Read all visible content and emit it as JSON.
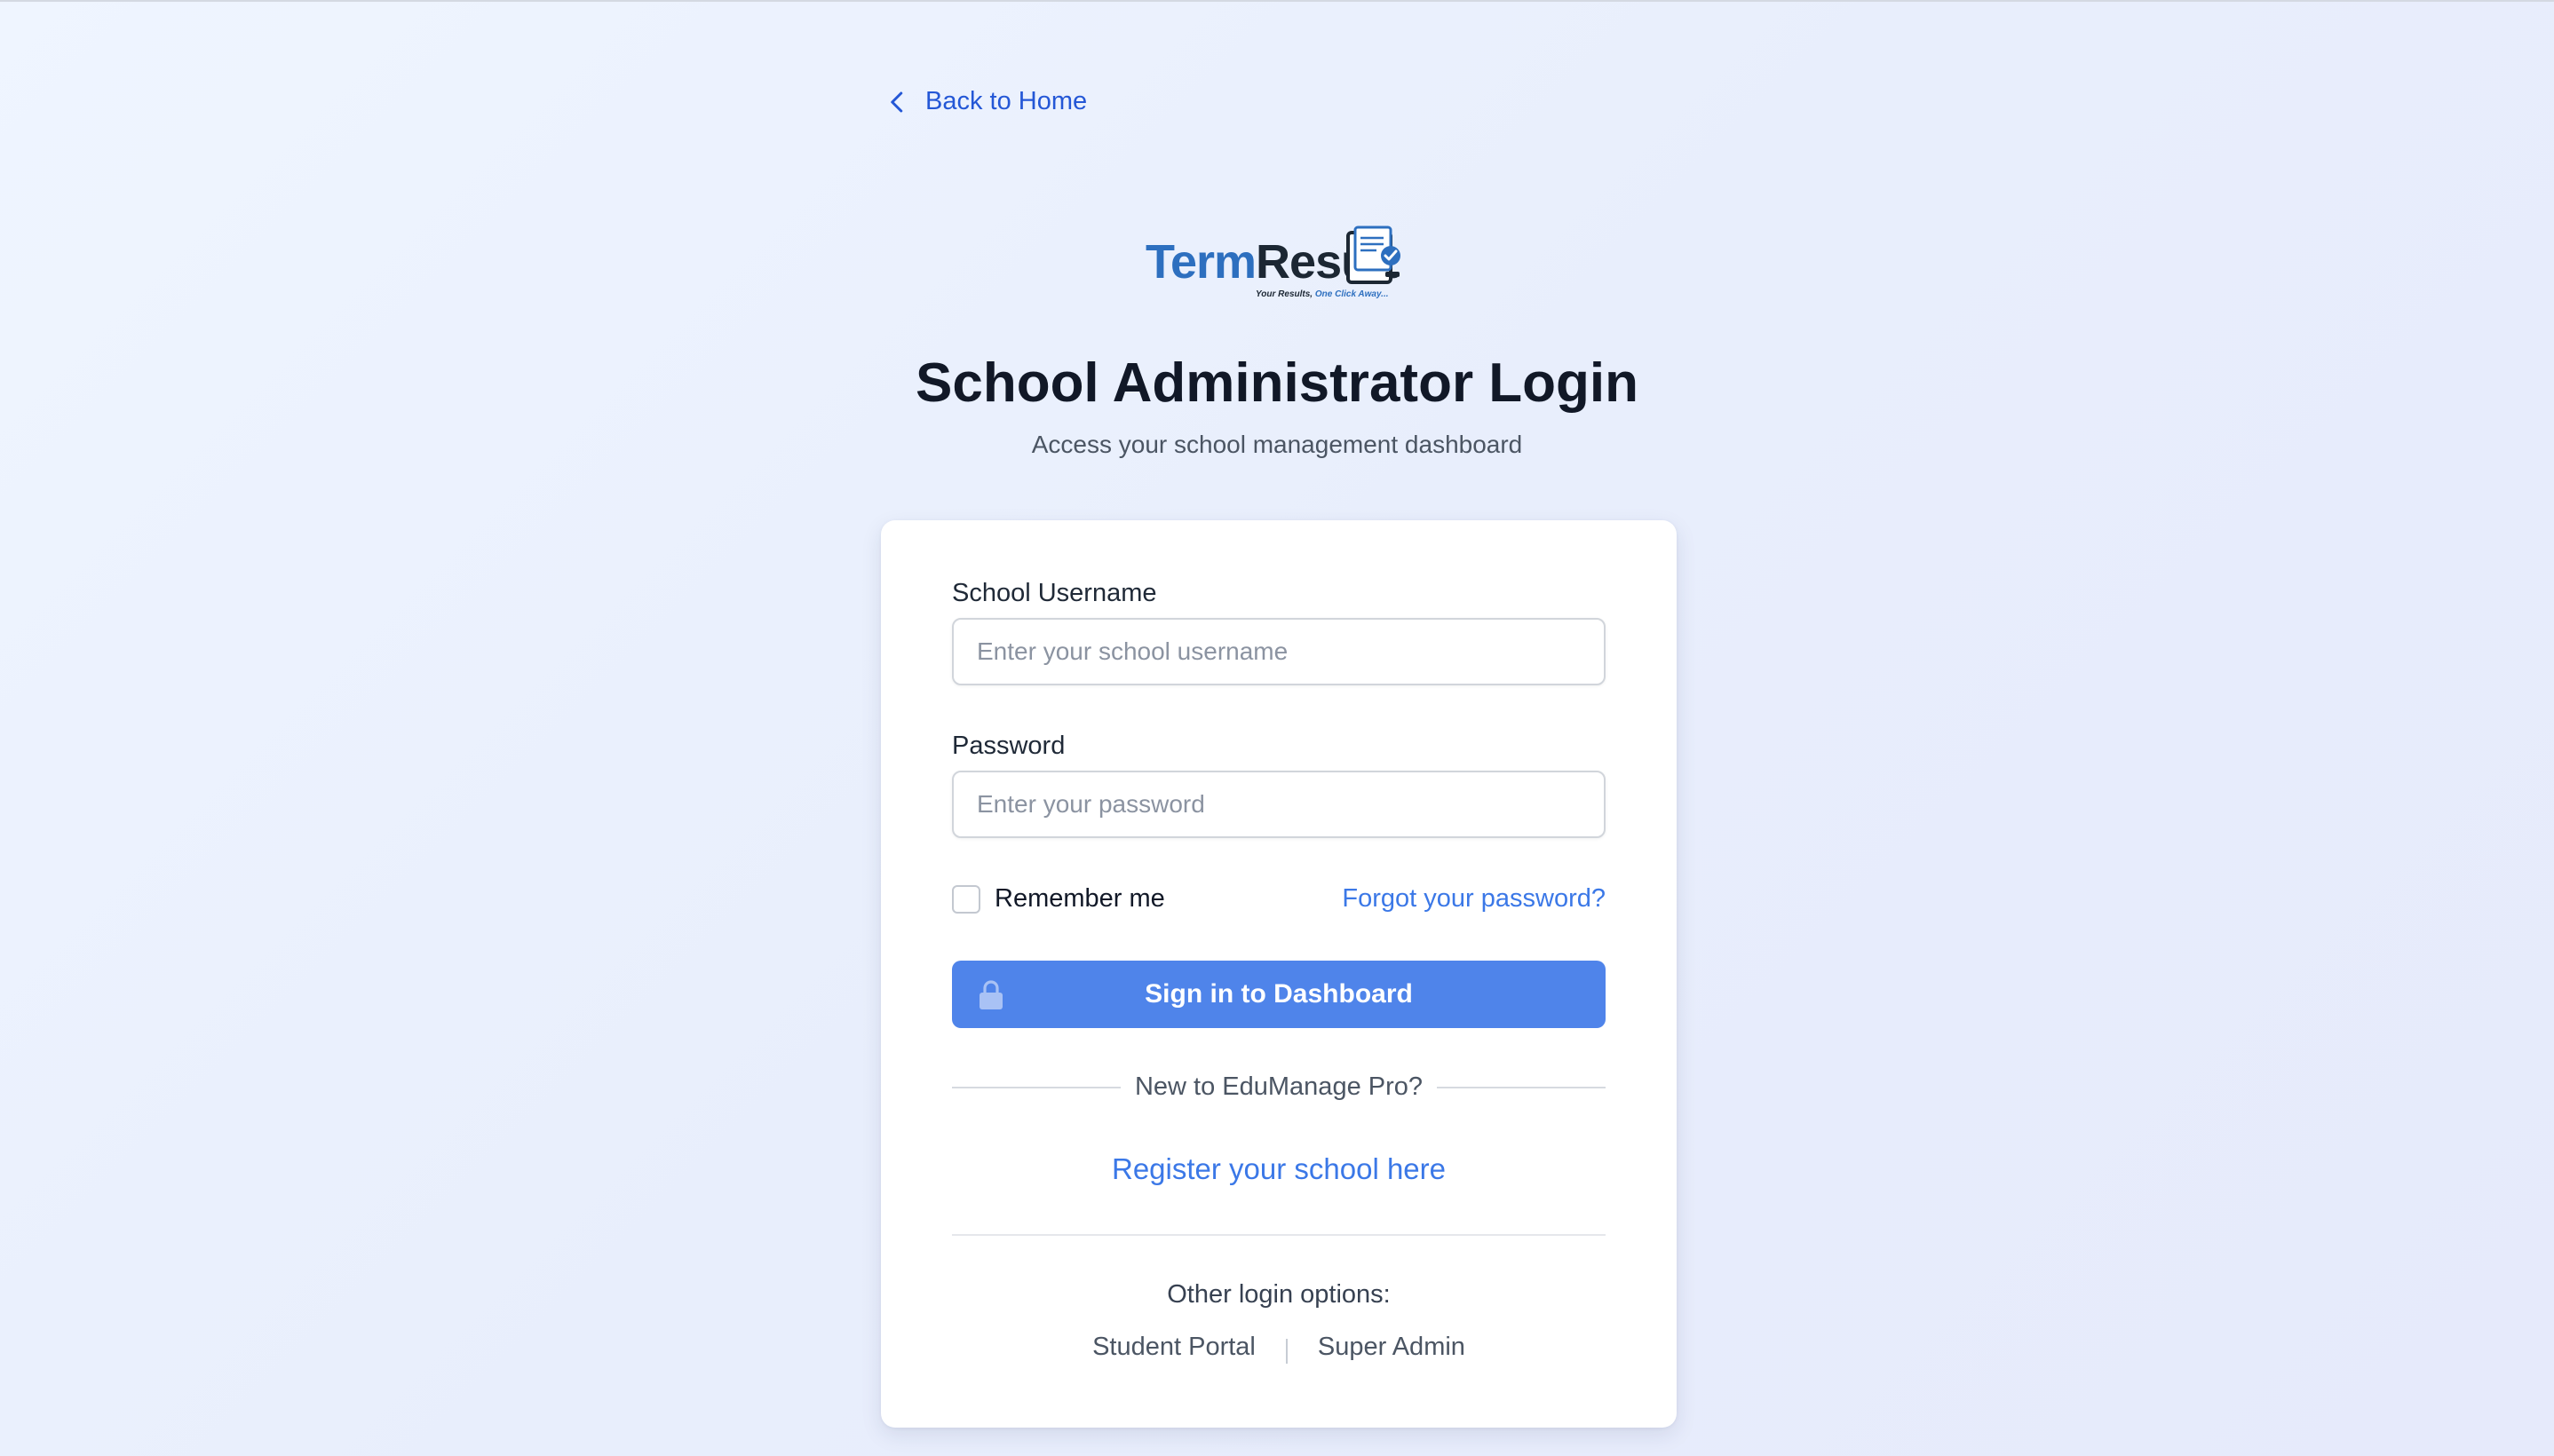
{
  "nav": {
    "back_label": "Back to Home"
  },
  "logo": {
    "brand_part1": "Term",
    "brand_part2": "Result",
    "tagline_part1": "Your Results,",
    "tagline_part2": "One Click Away..."
  },
  "header": {
    "title": "School Administrator Login",
    "subtitle": "Access your school management dashboard"
  },
  "form": {
    "username_label": "School Username",
    "username_placeholder": "Enter your school username",
    "username_value": "",
    "password_label": "Password",
    "password_placeholder": "Enter your password",
    "password_value": "",
    "remember_label": "Remember me",
    "remember_checked": false,
    "forgot_label": "Forgot your password?",
    "submit_label": "Sign in to Dashboard"
  },
  "register": {
    "divider_text": "New to EduManage Pro?",
    "link_label": "Register your school here"
  },
  "other_options": {
    "label": "Other login options:",
    "links": [
      "Student Portal",
      "Super Admin"
    ]
  },
  "colors": {
    "accent": "#3b78e7",
    "button": "#4f84ea",
    "brand_blue": "#2d6fbf",
    "brand_dark": "#1c2733"
  }
}
